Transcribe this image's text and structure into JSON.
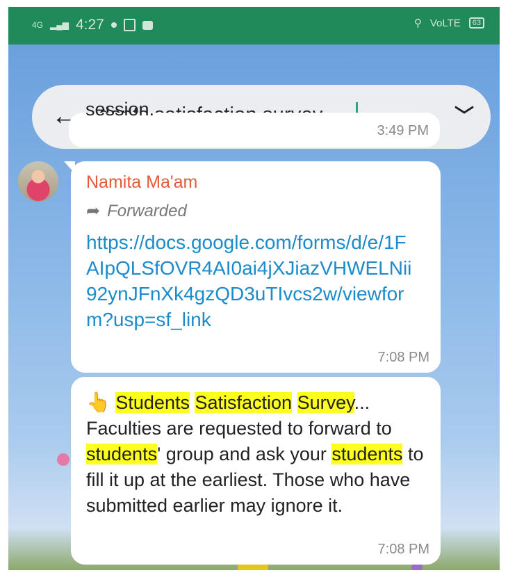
{
  "status_bar": {
    "network": "4G",
    "time": "4:27",
    "volte": "VoLTE",
    "battery": "63"
  },
  "search": {
    "query": "dents satisfaction survey",
    "back_icon": "arrow-left-icon",
    "up_icon": "chevron-up-icon",
    "down_icon": "chevron-down-icon"
  },
  "messages": [
    {
      "partial_text": "session.",
      "time": "3:49 PM"
    },
    {
      "sender": "Namita Ma'am",
      "forwarded_label": "Forwarded",
      "link": "https://docs.google.com/forms/d/e/1FAIpQLSfOVR4AI0ai4jXJiazVHWELNii92ynJFnXk4gzQD3uTIvcs2w/viewform?usp=sf_link",
      "time": "7:08 PM"
    },
    {
      "time": "7:08 PM",
      "parts": {
        "w1": "Students",
        "w2": "Satisfaction",
        "w3": "Survey",
        "s1": "...",
        "s2": "Faculties are requested to forward to ",
        "w4": "students",
        "s3": "' group and ask your ",
        "w5": "students",
        "s4": " to fill it up at the earliest. Those who have submitted earlier may ignore it."
      }
    }
  ],
  "colors": {
    "status_bar": "#1f8a5a",
    "sender_name": "#e45a3a",
    "link": "#1b8bcb",
    "highlight": "#ffff1f"
  }
}
